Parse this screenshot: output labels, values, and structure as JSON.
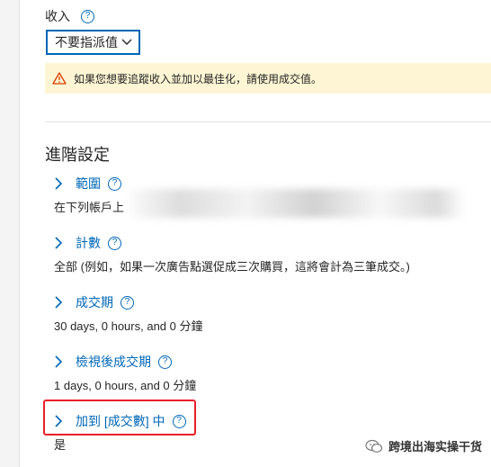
{
  "top_partial": {
    "text": "",
    "link": ""
  },
  "revenue": {
    "label": "收入",
    "select_value": "不要指派值",
    "warning": "如果您想要追蹤收入並加以最佳化，請使用成交值。"
  },
  "advanced": {
    "title": "進階設定",
    "items": [
      {
        "title": "範圍",
        "value": "在下列帳戶上"
      },
      {
        "title": "計數",
        "value": "全部 (例如，如果一次廣告點選促成三次購買，這將會計為三筆成交。)"
      },
      {
        "title": "成交期",
        "value": "30 days, 0 hours, and 0 分鐘"
      },
      {
        "title": "檢視後成交期",
        "value": "1 days, 0 hours, and 0 分鐘"
      },
      {
        "title": "加到 [成交數] 中",
        "value": "是"
      }
    ]
  },
  "watermark": {
    "text": "跨境出海实操干货"
  },
  "colors": {
    "link": "#0067b8",
    "warning_bg": "#fdf5d3",
    "highlight": "#e8202a"
  }
}
